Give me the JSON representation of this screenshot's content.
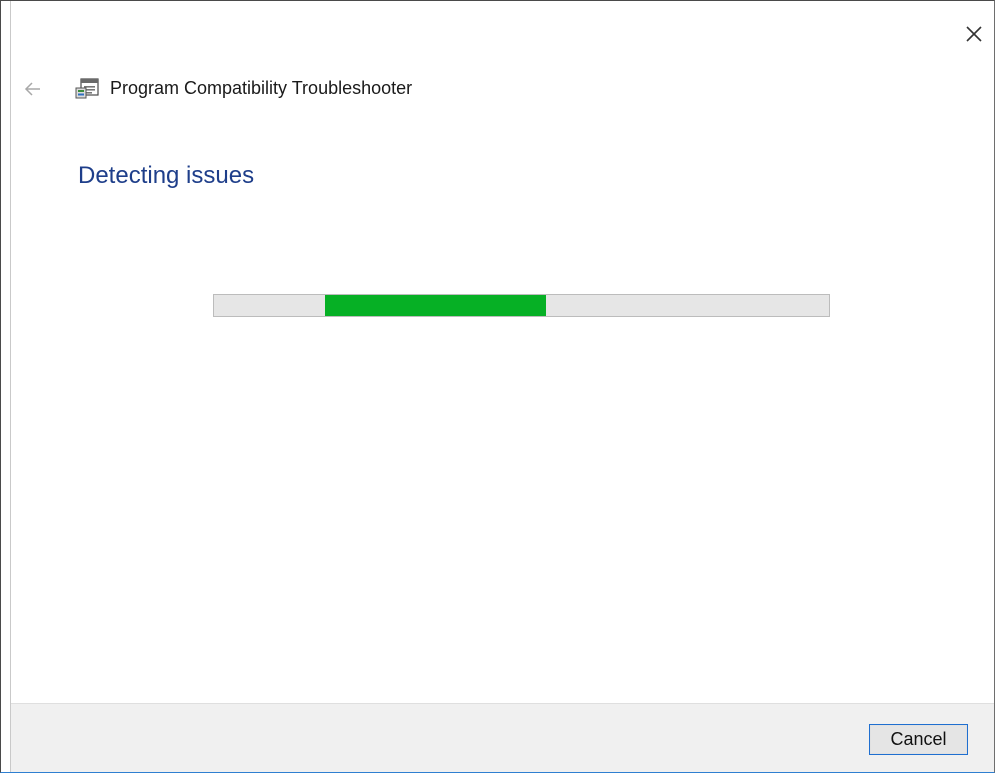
{
  "window": {
    "title": "Program Compatibility Troubleshooter",
    "close_icon": "close-icon",
    "back_icon": "back-arrow-icon",
    "app_icon": "troubleshooter-icon"
  },
  "main": {
    "heading": "Detecting issues",
    "progress": {
      "mode": "indeterminate",
      "fill_start_fraction": 0.18,
      "fill_end_fraction": 0.54,
      "fill_color": "#06b025",
      "track_color": "#e6e6e6"
    }
  },
  "footer": {
    "cancel_label": "Cancel"
  },
  "colors": {
    "heading": "#1e3e8a",
    "footer_bg": "#f0f0f0",
    "button_border": "#1f6fd0"
  }
}
